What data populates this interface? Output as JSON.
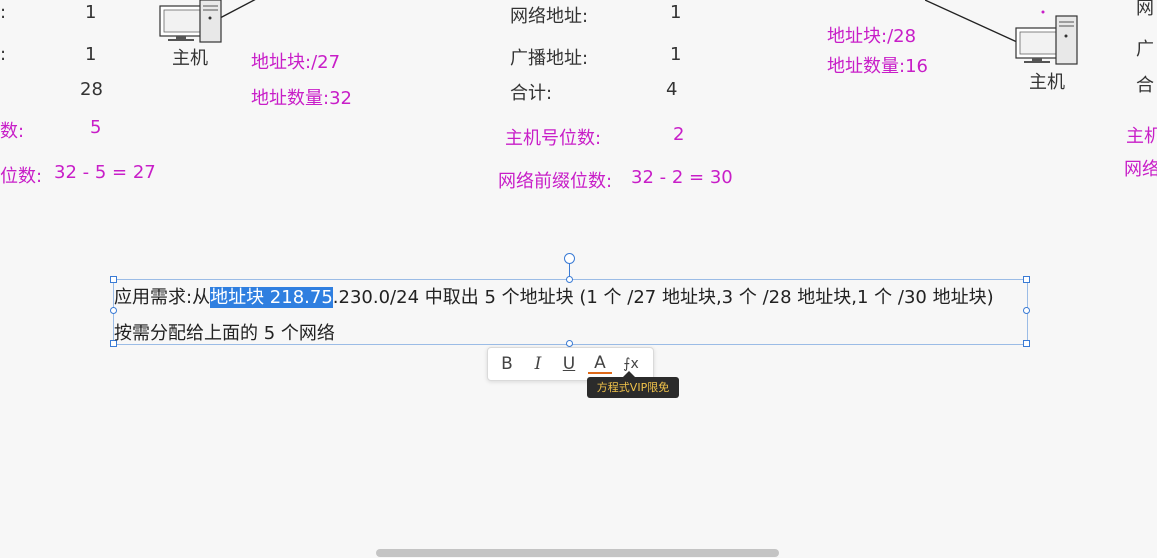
{
  "left_block": {
    "row1_label": ":",
    "row1_value": "1",
    "row2_label": ":",
    "row2_value": "1",
    "row3_value": "28",
    "host_bits_label": "数:",
    "host_bits_value": "5",
    "prefix_label": "位数:",
    "prefix_calc": "32 - 5 = 27"
  },
  "pc_left": {
    "label": "主机"
  },
  "left_block_info": {
    "addr_block": "地址块:/27",
    "addr_count": "地址数量:32"
  },
  "middle_block": {
    "network_addr_label": "网络地址:",
    "network_addr_value": "1",
    "broadcast_label": "广播地址:",
    "broadcast_value": "1",
    "total_label": "合计:",
    "total_value": "4",
    "host_bits_label": "主机号位数:",
    "host_bits_value": "2",
    "prefix_label": "网络前缀位数:",
    "prefix_calc": "32 - 2 = 30"
  },
  "right_block_info": {
    "addr_block": "地址块:/28",
    "addr_count": "地址数量:16"
  },
  "pc_right": {
    "label": "主机"
  },
  "far_right": {
    "line1": "网",
    "line2": "广",
    "line3": "合",
    "line4": "主机",
    "line5": "网络"
  },
  "textbox": {
    "line1_prefix": "应用需求:从",
    "line1_selected": "地址块 218.75",
    "line1_suffix": ".230.0/24 中取出 5 个地址块 (1 个 /27 地址块,3 个 /28 地址块,1 个 /30 地址块)",
    "line2": "按需分配给上面的 5 个网络"
  },
  "format_toolbar": {
    "bold": "B",
    "italic": "I",
    "underline": "U",
    "font_color": "A",
    "formula": "⨍x",
    "vip_tooltip": "方程式VIP限免"
  },
  "colors": {
    "magenta": "#c81ec8",
    "selection": "#2f7fe0",
    "accent": "#3a7bd5"
  }
}
